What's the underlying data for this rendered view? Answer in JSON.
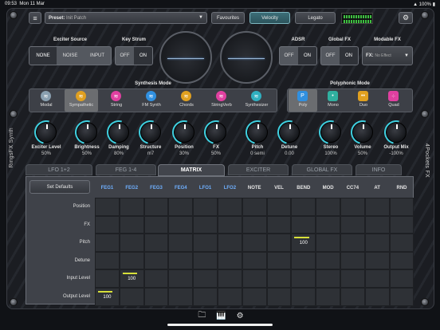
{
  "status": {
    "time": "09:53",
    "date": "Mon 11 Mar",
    "battery": "100%"
  },
  "header": {
    "preset_label": "Preset:",
    "preset_value": "Init Patch",
    "favourites": "Favourites",
    "velocity": "Velocity",
    "legato": "Legato"
  },
  "exciter": {
    "title": "Exciter Source",
    "options": [
      "NONE",
      "NOISE",
      "INPUT"
    ],
    "selected": "NONE"
  },
  "keystrum": {
    "title": "Key Strum",
    "off": "OFF",
    "on": "ON",
    "selected": "ON"
  },
  "adsr": {
    "title": "ADSR",
    "off": "OFF",
    "on": "ON",
    "selected": "ON"
  },
  "globalfx": {
    "title": "Global FX",
    "off": "OFF",
    "on": "ON",
    "selected": "ON"
  },
  "modfx": {
    "title": "Modable FX",
    "label": "FX:",
    "value": "No Effect"
  },
  "synth_mode": {
    "title": "Synthesis Mode",
    "items": [
      {
        "label": "Modal",
        "icon": "target-icon",
        "color": "#8aa0b0"
      },
      {
        "label": "Sympathetic",
        "icon": "strings-icon",
        "color": "#e0a020"
      },
      {
        "label": "String",
        "icon": "string-icon",
        "color": "#e040a0"
      },
      {
        "label": "FM Synth",
        "icon": "fm-icon",
        "color": "#3090e0"
      },
      {
        "label": "Chords",
        "icon": "chords-icon",
        "color": "#e0a020"
      },
      {
        "label": "StringVerb",
        "icon": "stringverb-icon",
        "color": "#e040a0"
      },
      {
        "label": "Synthesizer",
        "icon": "wave-icon",
        "color": "#30b0c0"
      }
    ],
    "selected": "Sympathetic"
  },
  "poly_mode": {
    "title": "Polyphonic Mode",
    "items": [
      {
        "label": "Poly",
        "glyph": "P",
        "color": "#3090e0"
      },
      {
        "label": "Mono",
        "glyph": "•",
        "color": "#30b0a0"
      },
      {
        "label": "Duo",
        "glyph": "••",
        "color": "#e0a020"
      },
      {
        "label": "Quad",
        "glyph": "⁘",
        "color": "#e040a0"
      }
    ],
    "selected": "Poly"
  },
  "knobs": [
    {
      "label": "Exciter Level",
      "value": "50%"
    },
    {
      "label": "Brightness",
      "value": "50%"
    },
    {
      "label": "Damping",
      "value": "80%"
    },
    {
      "label": "Structure",
      "value": "m7"
    },
    {
      "label": "Position",
      "value": "30%"
    },
    {
      "label": "FX",
      "value": "50%"
    },
    {
      "label": "Pitch",
      "value": "0 semi"
    },
    {
      "label": "Detune",
      "value": "0.00"
    },
    {
      "label": "Stereo",
      "value": "100%"
    },
    {
      "label": "Volume",
      "value": "50%"
    },
    {
      "label": "Output Mix",
      "value": "-100%"
    }
  ],
  "side": {
    "left": "RingsFX Synth",
    "right": "4Pockets FX"
  },
  "tabs": [
    "LFO 1+2",
    "FEG 1-4",
    "MATRIX",
    "EXCITER",
    "GLOBAL FX",
    "INFO"
  ],
  "active_tab": "MATRIX",
  "matrix": {
    "set_defaults": "Set Defaults",
    "columns": [
      {
        "label": "FEG1",
        "color": "#6fb0ff"
      },
      {
        "label": "FEG2",
        "color": "#6fb0ff"
      },
      {
        "label": "FEG3",
        "color": "#6fb0ff"
      },
      {
        "label": "FEG4",
        "color": "#6fb0ff"
      },
      {
        "label": "LFO1",
        "color": "#6fb0ff"
      },
      {
        "label": "LFO2",
        "color": "#6fb0ff"
      },
      {
        "label": "NOTE",
        "color": "#e6e6e6"
      },
      {
        "label": "VEL",
        "color": "#e6e6e6"
      },
      {
        "label": "BEND",
        "color": "#e6e6e6"
      },
      {
        "label": "MOD",
        "color": "#e6e6e6"
      },
      {
        "label": "CC74",
        "color": "#e6e6e6"
      },
      {
        "label": "AT",
        "color": "#e6e6e6"
      },
      {
        "label": "RND",
        "color": "#e6e6e6"
      }
    ],
    "rows": [
      "Position",
      "FX",
      "Pitch",
      "Detune",
      "Input Level",
      "Output Level"
    ],
    "values": [
      {
        "row": 2,
        "col": 8,
        "value": "100"
      },
      {
        "row": 4,
        "col": 1,
        "value": "100"
      },
      {
        "row": 5,
        "col": 0,
        "value": "100"
      }
    ]
  }
}
